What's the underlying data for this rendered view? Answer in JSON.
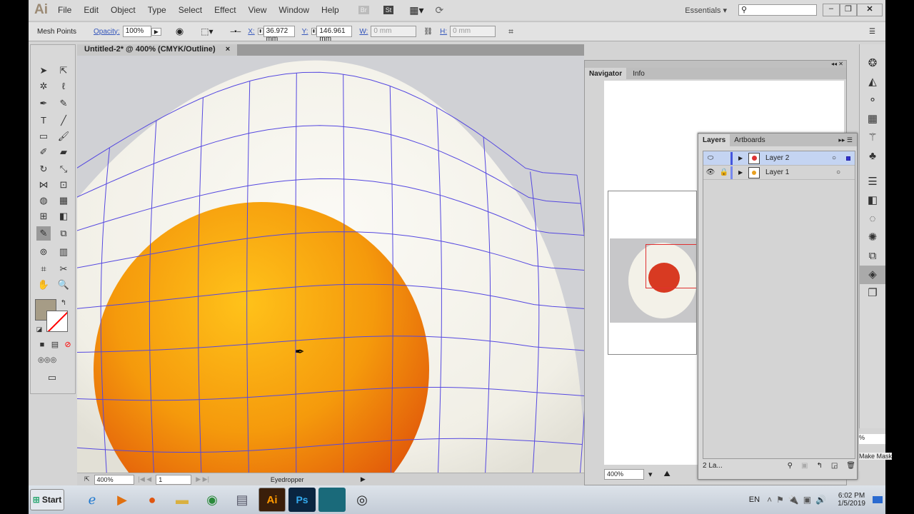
{
  "app": {
    "logo": "Ai",
    "menu": [
      "File",
      "Edit",
      "Object",
      "Type",
      "Select",
      "Effect",
      "View",
      "Window",
      "Help"
    ],
    "bridge": "Br",
    "stock": "St",
    "workspace": "Essentials",
    "search_placeholder": ""
  },
  "control": {
    "mode": "Mesh Points",
    "opacity_label": "Opacity:",
    "opacity": "100%",
    "x_label": "X:",
    "x": "36.972 mm",
    "y_label": "Y:",
    "y": "146.961 mm",
    "w_label": "W:",
    "w": "0 mm",
    "h_label": "H:",
    "h": "0 mm"
  },
  "document": {
    "tab": "Untitled-2* @ 400% (CMYK/Outline)",
    "close": "×"
  },
  "status": {
    "zoom": "400%",
    "artboard": "1",
    "tool": "Eyedropper"
  },
  "navigator": {
    "tabs": [
      "Navigator",
      "Info"
    ],
    "zoom": "400%"
  },
  "layers": {
    "tabs": [
      "Layers",
      "Artboards"
    ],
    "rows": [
      {
        "name": "Layer 2",
        "color": "#4455dd",
        "selected": true
      },
      {
        "name": "Layer 1",
        "color": "#7788ee",
        "selected": false
      }
    ],
    "count": "2 La..."
  },
  "dock_partial": {
    "percent": "%",
    "make_mask": "Make Mask"
  },
  "taskbar": {
    "start": "Start",
    "lang": "EN",
    "time": "6:02 PM",
    "date": "1/5/2019"
  },
  "colors": {
    "mesh": "#5548e0",
    "yolk": "#f39a10",
    "accent": "#c8d6f0"
  }
}
